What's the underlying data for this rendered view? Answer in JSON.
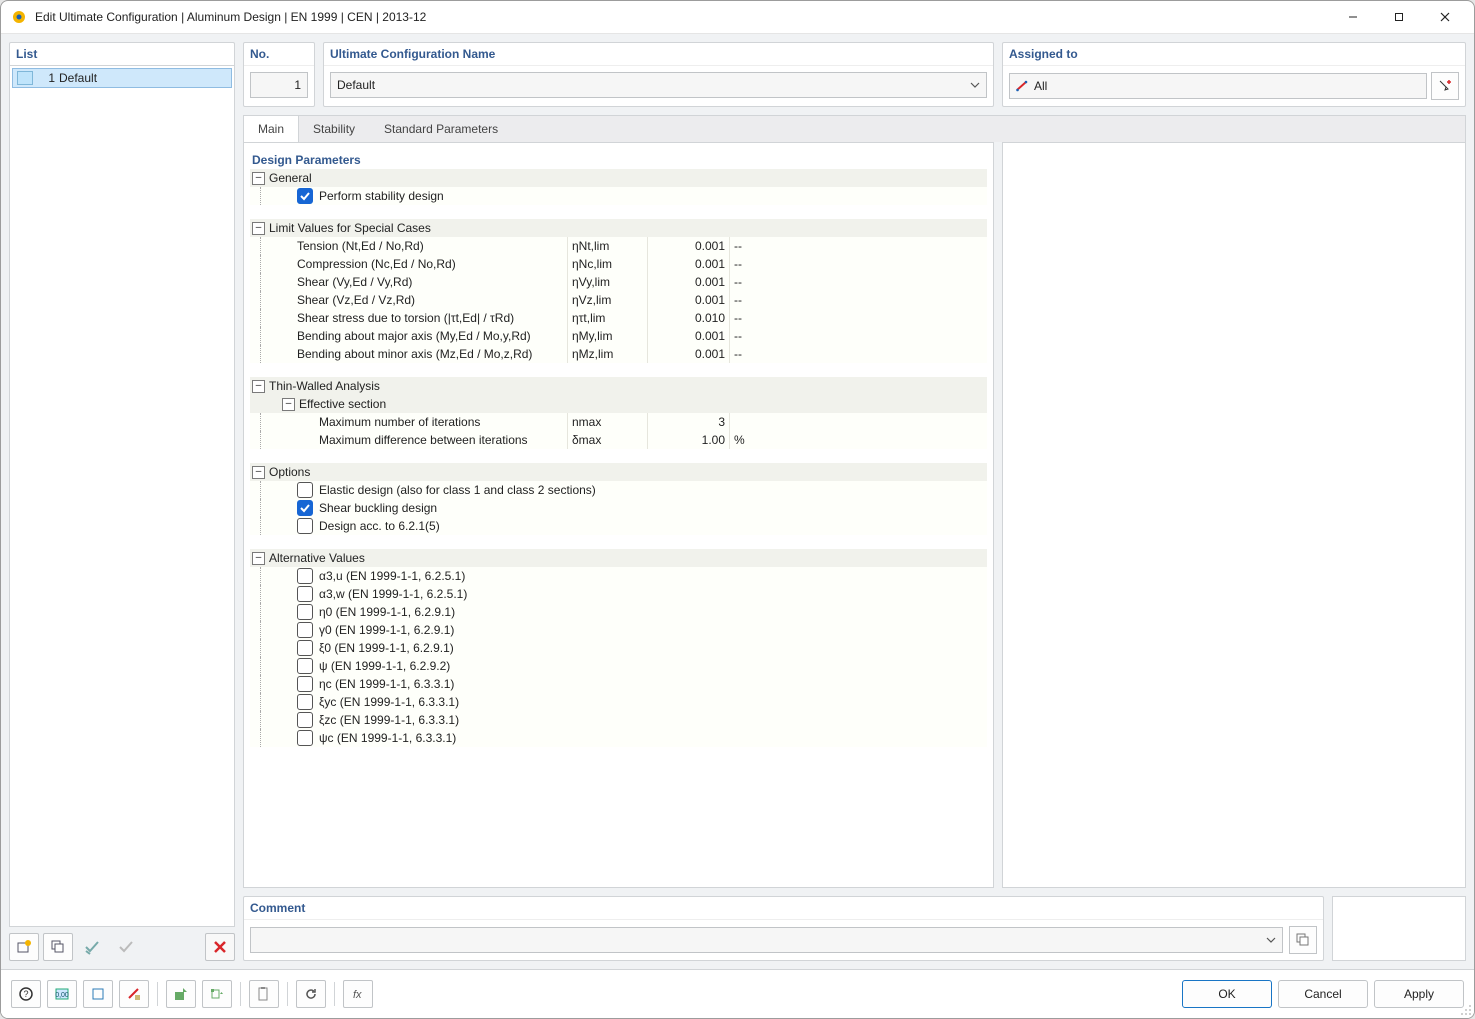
{
  "window": {
    "title": "Edit Ultimate Configuration | Aluminum Design | EN 1999 | CEN | 2013-12"
  },
  "sidebar": {
    "header": "List",
    "items": [
      {
        "num": "1",
        "label": "Default"
      }
    ]
  },
  "top": {
    "no_header": "No.",
    "no_value": "1",
    "name_header": "Ultimate Configuration Name",
    "name_value": "Default",
    "assigned_header": "Assigned to",
    "assigned_value": "All"
  },
  "tabs": {
    "main": "Main",
    "stability": "Stability",
    "standard": "Standard Parameters"
  },
  "content": {
    "section_title": "Design Parameters",
    "general": {
      "label": "General",
      "perform_stability": "Perform stability design"
    },
    "limit": {
      "label": "Limit Values for Special Cases",
      "rows": [
        {
          "name": "Tension (Nt,Ed / No,Rd)",
          "sym": "ηNt,lim",
          "val": "0.001",
          "unit": "--"
        },
        {
          "name": "Compression (Nc,Ed / No,Rd)",
          "sym": "ηNc,lim",
          "val": "0.001",
          "unit": "--"
        },
        {
          "name": "Shear (Vy,Ed / Vy,Rd)",
          "sym": "ηVy,lim",
          "val": "0.001",
          "unit": "--"
        },
        {
          "name": "Shear (Vz,Ed / Vz,Rd)",
          "sym": "ηVz,lim",
          "val": "0.001",
          "unit": "--"
        },
        {
          "name": "Shear stress due to torsion (|τt,Ed| / τRd)",
          "sym": "ητt,lim",
          "val": "0.010",
          "unit": "--"
        },
        {
          "name": "Bending about major axis (My,Ed / Mo,y,Rd)",
          "sym": "ηMy,lim",
          "val": "0.001",
          "unit": "--"
        },
        {
          "name": "Bending about minor axis (Mz,Ed / Mo,z,Rd)",
          "sym": "ηMz,lim",
          "val": "0.001",
          "unit": "--"
        }
      ]
    },
    "thin": {
      "label": "Thin-Walled Analysis",
      "sub_label": "Effective section",
      "rows": [
        {
          "name": "Maximum number of iterations",
          "sym": "nmax",
          "val": "3",
          "unit": ""
        },
        {
          "name": "Maximum difference between iterations",
          "sym": "δmax",
          "val": "1.00",
          "unit": "%"
        }
      ]
    },
    "options": {
      "label": "Options",
      "items": [
        {
          "label": "Elastic design (also for class 1 and class 2 sections)",
          "checked": false
        },
        {
          "label": "Shear buckling design",
          "checked": true
        },
        {
          "label": "Design acc. to 6.2.1(5)",
          "checked": false
        }
      ]
    },
    "alt": {
      "label": "Alternative Values",
      "items": [
        "α3,u (EN 1999-1-1, 6.2.5.1)",
        "α3,w (EN 1999-1-1, 6.2.5.1)",
        "η0 (EN 1999-1-1, 6.2.9.1)",
        "γ0 (EN 1999-1-1, 6.2.9.1)",
        "ξ0 (EN 1999-1-1, 6.2.9.1)",
        "ψ (EN 1999-1-1, 6.2.9.2)",
        "ηc (EN 1999-1-1, 6.3.3.1)",
        "ξyc (EN 1999-1-1, 6.3.3.1)",
        "ξzc (EN 1999-1-1, 6.3.3.1)",
        "ψc (EN 1999-1-1, 6.3.3.1)"
      ]
    }
  },
  "comment": {
    "header": "Comment",
    "value": ""
  },
  "buttons": {
    "ok": "OK",
    "cancel": "Cancel",
    "apply": "Apply"
  }
}
